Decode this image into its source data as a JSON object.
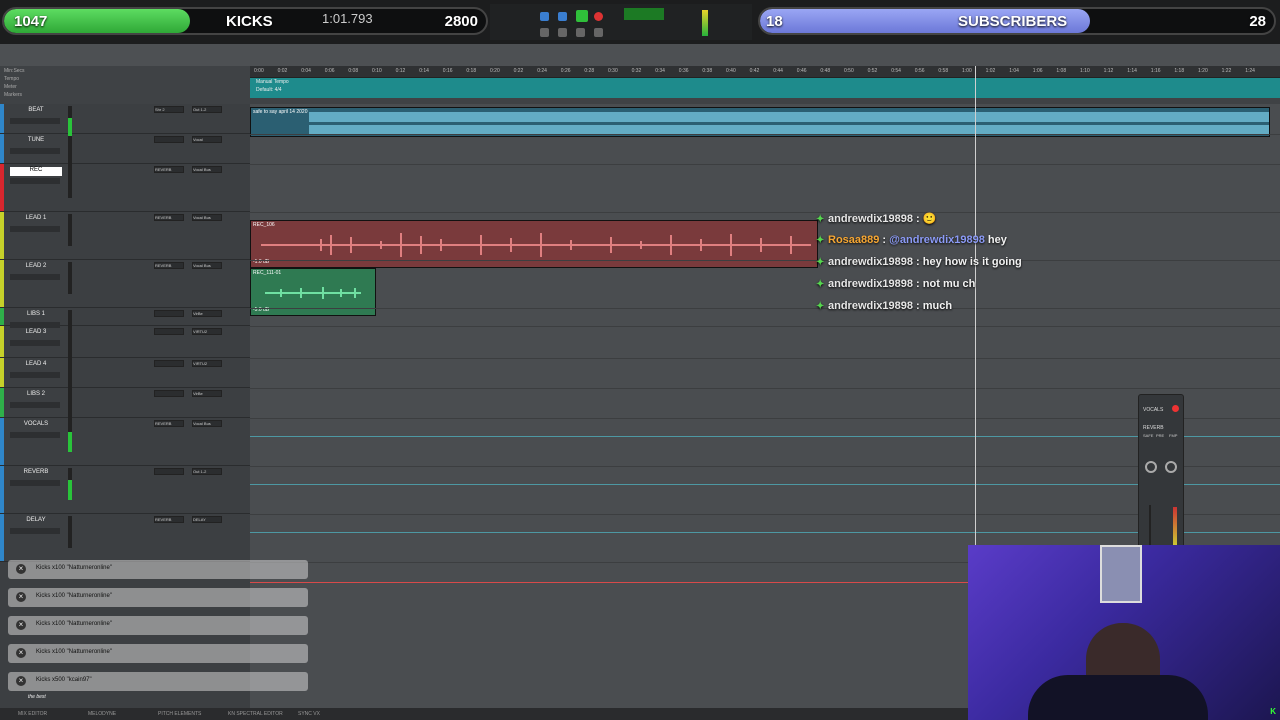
{
  "overlay": {
    "left_goal": {
      "count": "1047",
      "title": "KICKS",
      "target": "2800"
    },
    "right_goal": {
      "count": "18",
      "title": "SUBSCRIBERS",
      "target": "28"
    }
  },
  "transport": {
    "counter": "1:01.793"
  },
  "colors": {
    "goal_green": "#3fbf46",
    "goal_purple": "#7e8ae3",
    "tempo_teal": "#1e8b8c",
    "lead_clip": "#7a3a3c",
    "lead2_clip": "#2f7a52"
  },
  "rulers": {
    "labels": [
      "Min:Secs",
      "Tempo",
      "Meter",
      "Markers"
    ],
    "tempo_text": "Manual Tempo",
    "meter_text": "Default: 4/4"
  },
  "ruler_ticks": [
    "0:00",
    "0:02",
    "0:04",
    "0:06",
    "0:08",
    "0:10",
    "0:12",
    "0:14",
    "0:16",
    "0:18",
    "0:20",
    "0:22",
    "0:24",
    "0:26",
    "0:28",
    "0:30",
    "0:32",
    "0:34",
    "0:36",
    "0:38",
    "0:40",
    "0:42",
    "0:44",
    "0:46",
    "0:48",
    "0:50",
    "0:52",
    "0:54",
    "0:56",
    "0:58",
    "1:00",
    "1:02",
    "1:04",
    "1:06",
    "1:08",
    "1:10",
    "1:12",
    "1:14",
    "1:16",
    "1:18",
    "1:20",
    "1:22",
    "1:24"
  ],
  "tracks": [
    {
      "name": "BEAT",
      "color": "#2f86c9",
      "insert": "Shr 2",
      "out": "Out 1-2",
      "height": 30
    },
    {
      "name": "TUNE",
      "color": "#2f86c9",
      "insert": "",
      "out": "Vocal",
      "height": 30
    },
    {
      "name": "REC",
      "color": "#d8262e",
      "insert": "REVERB",
      "out": "Vocal Bus",
      "height": 48,
      "rec": true
    },
    {
      "name": "LEAD 1",
      "color": "#c6d12a",
      "insert": "REVERB",
      "out": "Vocal Bus",
      "height": 48
    },
    {
      "name": "LEAD 2",
      "color": "#c6d12a",
      "insert": "REVERB",
      "out": "Vocal Bus",
      "height": 48
    },
    {
      "name": "LIBS 1",
      "color": "#2fb04a",
      "insert": "",
      "out": "VirBe",
      "height": 18
    },
    {
      "name": "LEAD 3",
      "color": "#c6d12a",
      "insert": "",
      "out": "VIRTU2",
      "height": 32
    },
    {
      "name": "LEAD 4",
      "color": "#c6d12a",
      "insert": "",
      "out": "VIRTU2",
      "height": 30
    },
    {
      "name": "LIBS 2",
      "color": "#2fb04a",
      "insert": "",
      "out": "VirBe",
      "height": 30
    },
    {
      "name": "VOCALS",
      "color": "#2f86c9",
      "insert": "REVERB",
      "out": "Vocal Bus",
      "height": 48
    },
    {
      "name": "REVERB",
      "color": "#2f86c9",
      "insert": "",
      "out": "Out 1-2",
      "height": 48
    },
    {
      "name": "DELAY",
      "color": "#2f86c9",
      "insert": "REVERB",
      "out": "DELAY",
      "height": 48
    }
  ],
  "clips": {
    "beat_name": "safe to say april 14 2020",
    "lead1_name": "REC_106",
    "lead1_level": "-1.0 dB",
    "lead2_name": "REC_111-01",
    "lead2_level": "-5.0 dB"
  },
  "chat": [
    {
      "user": "andrewdix19898",
      "sep": " : ",
      "text": "🙂",
      "user_color": "#e7e7e7"
    },
    {
      "user": "Rosaa889",
      "sep": " : ",
      "mention": "@andrewdix19898",
      "text": " hey",
      "user_color": "#f7a733"
    },
    {
      "user": "andrewdix19898",
      "sep": " : ",
      "text": "hey how is it going",
      "user_color": "#e7e7e7"
    },
    {
      "user": "andrewdix19898",
      "sep": " : ",
      "text": "not mu ch",
      "user_color": "#e7e7e7"
    },
    {
      "user": "andrewdix19898",
      "sep": " : ",
      "text": "much",
      "user_color": "#e7e7e7"
    }
  ],
  "mini_plugin": {
    "title": "VOCALS",
    "insert": "REVERB",
    "buttons": [
      "SAFE",
      "PRE",
      "FMP"
    ]
  },
  "alerts": [
    {
      "text": "Kicks x100 \"Natturneronline\""
    },
    {
      "text": "Kicks x100 \"Natturneronline\""
    },
    {
      "text": "Kicks x100 \"Natturneronline\""
    },
    {
      "text": "Kicks x100 \"Natturneronline\""
    },
    {
      "text": "Kicks x500 \"kcain97\"",
      "sub": "the best"
    }
  ],
  "bottom_tabs": [
    "MIX EDITOR",
    "MELODYNE",
    "PITCH ELEMENTS",
    "KN SPECTRAL EDITOR",
    "SYNC VX"
  ]
}
